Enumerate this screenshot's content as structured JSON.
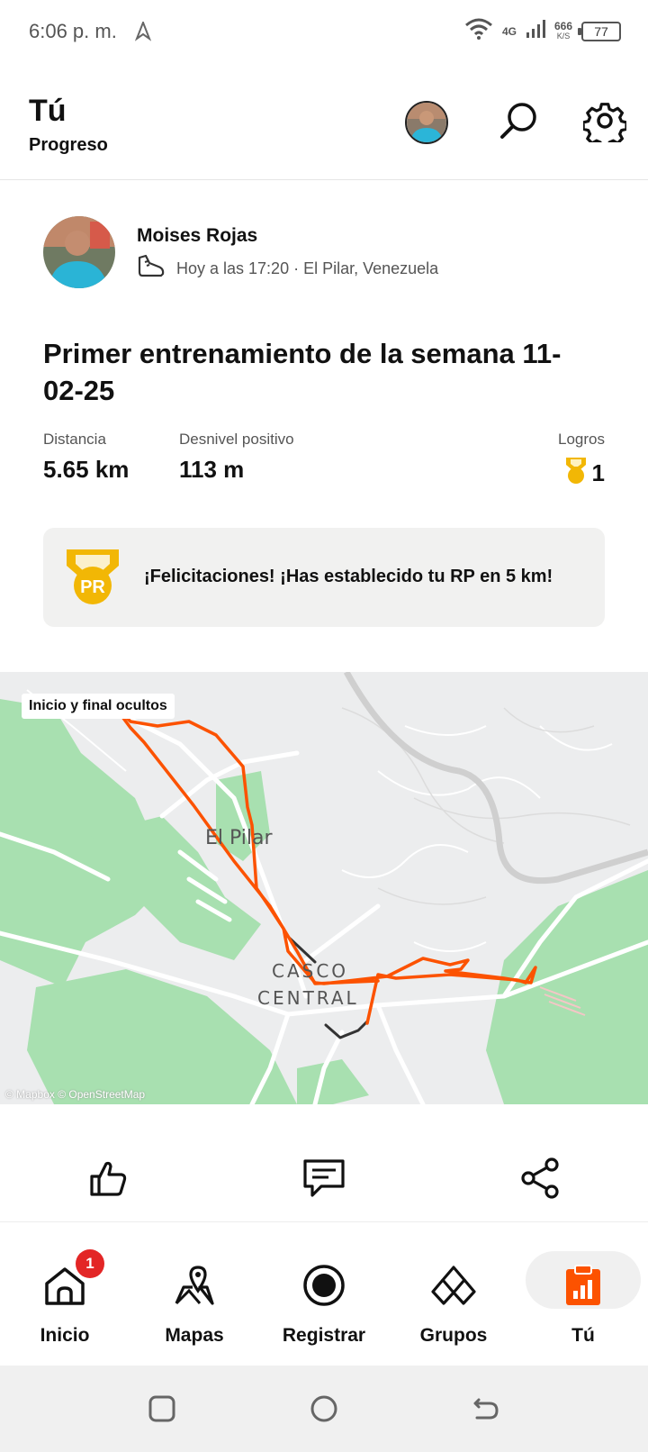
{
  "status_bar": {
    "time": "6:06 p. m.",
    "network_type": "4G",
    "speed_value": "666",
    "speed_unit": "K/S",
    "battery": "77"
  },
  "header": {
    "title": "Tú",
    "subtitle": "Progreso"
  },
  "activity": {
    "user_name": "Moises Rojas",
    "meta": "Hoy a las 17:20 · El Pilar, Venezuela",
    "title": "Primer entrenamiento de la semana 11-02-25",
    "stats": {
      "distance_label": "Distancia",
      "distance_value": "5.65 km",
      "elevation_label": "Desnivel positivo",
      "elevation_value": "113 m",
      "achievements_label": "Logros",
      "achievements_value": "1"
    },
    "pr_badge_text": "PR",
    "pr_message": "¡Felicitaciones! ¡Has establecido tu RP en 5 km!"
  },
  "map": {
    "overlay_label": "Inicio y final ocultos",
    "town_1": "El Pilar",
    "town_2_line1": "CASCO",
    "town_2_line2": "CENTRAL",
    "attribution": "© Mapbox © OpenStreetMap",
    "route_color": "#fc5200"
  },
  "bottom_nav": {
    "items": [
      {
        "label": "Inicio",
        "icon": "home-icon",
        "badge": "1"
      },
      {
        "label": "Mapas",
        "icon": "map-icon"
      },
      {
        "label": "Registrar",
        "icon": "record-icon"
      },
      {
        "label": "Grupos",
        "icon": "groups-icon"
      },
      {
        "label": "Tú",
        "icon": "you-icon",
        "active": true
      }
    ]
  },
  "colors": {
    "accent": "#fc5200",
    "gold": "#f2b705",
    "map_green": "#a8e0b0"
  }
}
